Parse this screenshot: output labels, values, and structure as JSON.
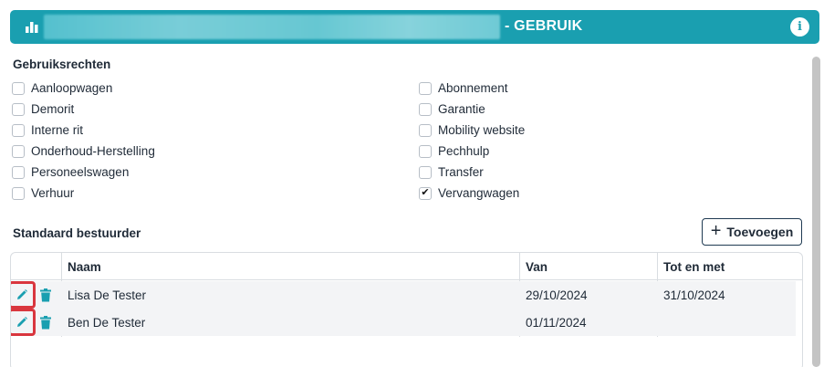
{
  "header": {
    "title": "- GEBRUIK"
  },
  "rights": {
    "label": "Gebruiksrechten",
    "left": [
      {
        "label": "Aanloopwagen",
        "checked": false
      },
      {
        "label": "Demorit",
        "checked": false
      },
      {
        "label": "Interne rit",
        "checked": false
      },
      {
        "label": "Onderhoud-Herstelling",
        "checked": false
      },
      {
        "label": "Personeelswagen",
        "checked": false
      },
      {
        "label": "Verhuur",
        "checked": false
      }
    ],
    "right": [
      {
        "label": "Abonnement",
        "checked": false
      },
      {
        "label": "Garantie",
        "checked": false
      },
      {
        "label": "Mobility website",
        "checked": false
      },
      {
        "label": "Pechhulp",
        "checked": false
      },
      {
        "label": "Transfer",
        "checked": false
      },
      {
        "label": "Vervangwagen",
        "checked": true
      }
    ]
  },
  "drivers": {
    "label": "Standaard bestuurder",
    "add_label": "Toevoegen",
    "columns": [
      "Naam",
      "Van",
      "Tot en met"
    ],
    "rows": [
      {
        "naam": "Lisa De Tester",
        "van": "29/10/2024",
        "tot": "31/10/2024"
      },
      {
        "naam": "Ben De Tester",
        "van": "01/11/2024",
        "tot": ""
      }
    ]
  },
  "colors": {
    "accent": "#1a9fb0",
    "highlight": "#d9363e",
    "row_alt": "#f3f4f6"
  }
}
